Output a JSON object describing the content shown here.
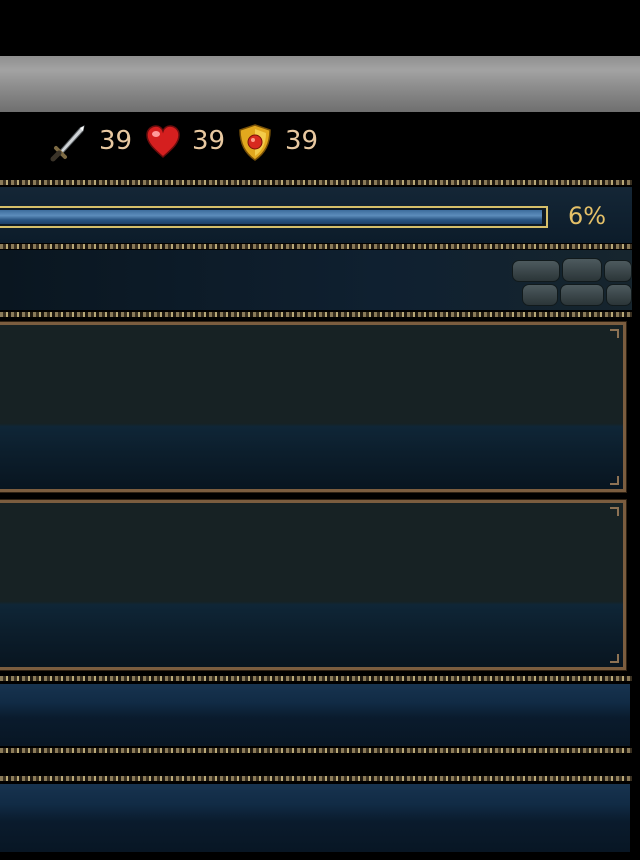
{
  "stats": {
    "attack": {
      "icon": "sword-icon",
      "value": "39"
    },
    "health": {
      "icon": "heart-icon",
      "value": "39"
    },
    "defense": {
      "icon": "shield-icon",
      "value": "39"
    }
  },
  "xp_bar": {
    "progress": 0.06,
    "label": "6%"
  },
  "colors": {
    "accent_gold": "#e4c068",
    "stat_text": "#e8c8a0",
    "frame_bronze": "#7b5d3f",
    "panel_bg": "#172224",
    "blue_row": "#17334f"
  }
}
